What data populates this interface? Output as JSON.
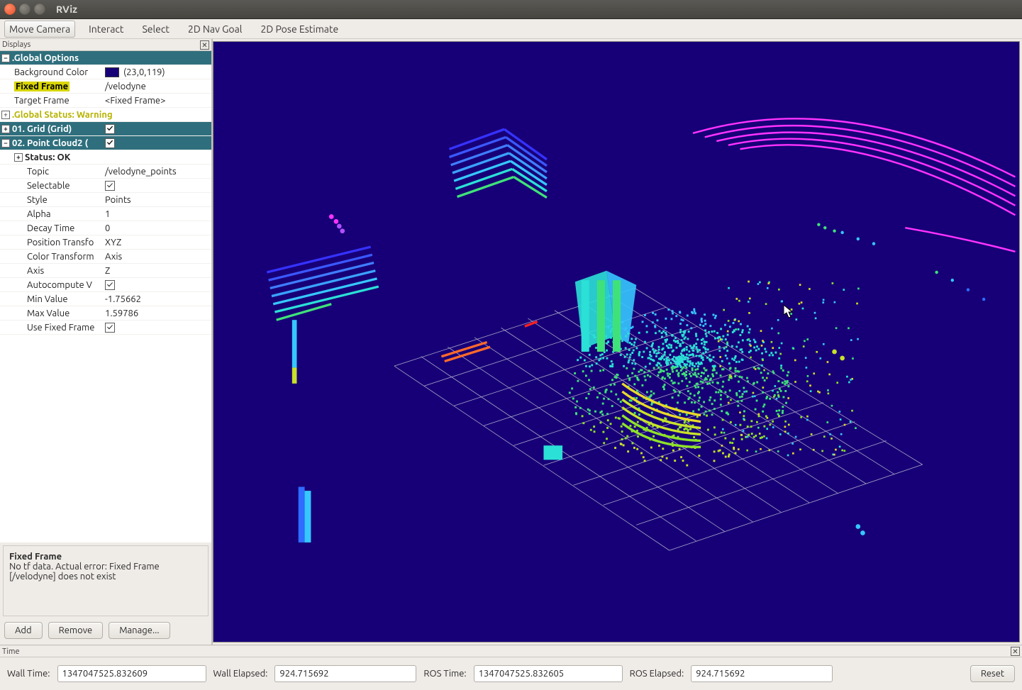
{
  "window": {
    "title": "RViz"
  },
  "toolbar": {
    "move_camera": "Move Camera",
    "interact": "Interact",
    "select": "Select",
    "nav_goal": "2D Nav Goal",
    "pose_estimate": "2D Pose Estimate"
  },
  "displays_panel": {
    "header": "Displays",
    "tree": {
      "global_options_label": ".Global Options",
      "bg_color_key": "Background Color",
      "bg_color_val": "(23,0,119)",
      "fixed_frame_key": "Fixed Frame",
      "fixed_frame_val": "/velodyne",
      "target_frame_key": "Target Frame",
      "target_frame_val": "<Fixed Frame>",
      "global_status_label": ".Global Status: Warning",
      "grid_label": "01. Grid (Grid)",
      "pc2_label": "02. Point Cloud2 (",
      "status_ok": "Status: OK",
      "topic_key": "Topic",
      "topic_val": "/velodyne_points",
      "selectable_key": "Selectable",
      "style_key": "Style",
      "style_val": "Points",
      "alpha_key": "Alpha",
      "alpha_val": "1",
      "decay_key": "Decay Time",
      "decay_val": "0",
      "pos_tf_key": "Position Transfo",
      "pos_tf_val": "XYZ",
      "color_tf_key": "Color Transform",
      "color_tf_val": "Axis",
      "axis_key": "Axis",
      "axis_val": "Z",
      "autocompute_key": "Autocompute V",
      "min_key": "Min Value",
      "min_val": "-1.75662",
      "max_key": "Max Value",
      "max_val": "1.59786",
      "use_fixed_key": "Use Fixed Frame"
    },
    "description": {
      "title": "Fixed Frame",
      "body": "No tf data. Actual error: Fixed Frame [/velodyne] does not exist"
    },
    "buttons": {
      "add": "Add",
      "remove": "Remove",
      "manage": "Manage..."
    }
  },
  "time_panel": {
    "header": "Time",
    "wall_time_label": "Wall Time:",
    "wall_time_val": "1347047525.832609",
    "wall_elapsed_label": "Wall Elapsed:",
    "wall_elapsed_val": "924.715692",
    "ros_time_label": "ROS Time:",
    "ros_time_val": "1347047525.832605",
    "ros_elapsed_label": "ROS Elapsed:",
    "ros_elapsed_val": "924.715692",
    "reset": "Reset"
  },
  "viewport": {
    "bg_color": "#170077"
  }
}
